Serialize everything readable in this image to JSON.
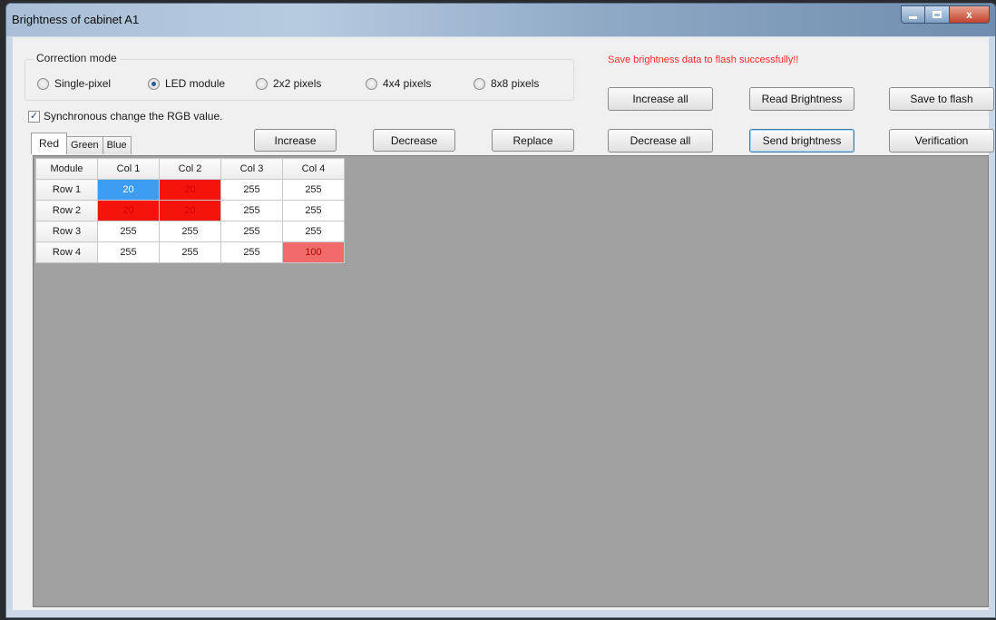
{
  "window": {
    "title": "Brightness of cabinet A1",
    "controls": {
      "minimize": "minimize",
      "maximize": "maximize",
      "close": "x"
    }
  },
  "correction": {
    "legend": "Correction mode",
    "options": [
      {
        "label": "Single-pixel",
        "selected": false
      },
      {
        "label": "LED module",
        "selected": true
      },
      {
        "label": "2x2 pixels",
        "selected": false
      },
      {
        "label": "4x4 pixels",
        "selected": false
      },
      {
        "label": "8x8 pixels",
        "selected": false
      }
    ]
  },
  "sync": {
    "label": "Synchronous change the RGB value.",
    "checked": true
  },
  "status": {
    "message": "Save brightness data to flash successfully!!",
    "color": "#ff2a2a"
  },
  "tabs": [
    {
      "label": "Red",
      "active": true
    },
    {
      "label": "Green",
      "active": false
    },
    {
      "label": "Blue",
      "active": false
    }
  ],
  "buttons": {
    "increase": "Increase",
    "decrease": "Decrease",
    "replace": "Replace",
    "increase_all": "Increase all",
    "decrease_all": "Decrease all",
    "read_brightness": "Read Brightness",
    "send_brightness": "Send brightness",
    "save_to_flash": "Save to flash",
    "verification": "Verification"
  },
  "grid": {
    "headers": [
      "Module",
      "Col 1",
      "Col 2",
      "Col 3",
      "Col 4"
    ],
    "rows": [
      {
        "label": "Row 1",
        "cells": [
          {
            "value": "20",
            "color": "#3d9df2",
            "text": "#ffffff"
          },
          {
            "value": "20",
            "color": "#f5140c",
            "text": "#d00000"
          },
          {
            "value": "255",
            "color": "#ffffff",
            "text": "#222222"
          },
          {
            "value": "255",
            "color": "#ffffff",
            "text": "#222222"
          }
        ]
      },
      {
        "label": "Row 2",
        "cells": [
          {
            "value": "20",
            "color": "#f5140c",
            "text": "#d00000"
          },
          {
            "value": "20",
            "color": "#f5140c",
            "text": "#d00000"
          },
          {
            "value": "255",
            "color": "#ffffff",
            "text": "#222222"
          },
          {
            "value": "255",
            "color": "#ffffff",
            "text": "#222222"
          }
        ]
      },
      {
        "label": "Row 3",
        "cells": [
          {
            "value": "255",
            "color": "#ffffff",
            "text": "#222222"
          },
          {
            "value": "255",
            "color": "#ffffff",
            "text": "#222222"
          },
          {
            "value": "255",
            "color": "#ffffff",
            "text": "#222222"
          },
          {
            "value": "255",
            "color": "#ffffff",
            "text": "#222222"
          }
        ]
      },
      {
        "label": "Row 4",
        "cells": [
          {
            "value": "255",
            "color": "#ffffff",
            "text": "#222222"
          },
          {
            "value": "255",
            "color": "#ffffff",
            "text": "#222222"
          },
          {
            "value": "255",
            "color": "#ffffff",
            "text": "#222222"
          },
          {
            "value": "100",
            "color": "#f26b6b",
            "text": "#b80000"
          }
        ]
      }
    ]
  }
}
